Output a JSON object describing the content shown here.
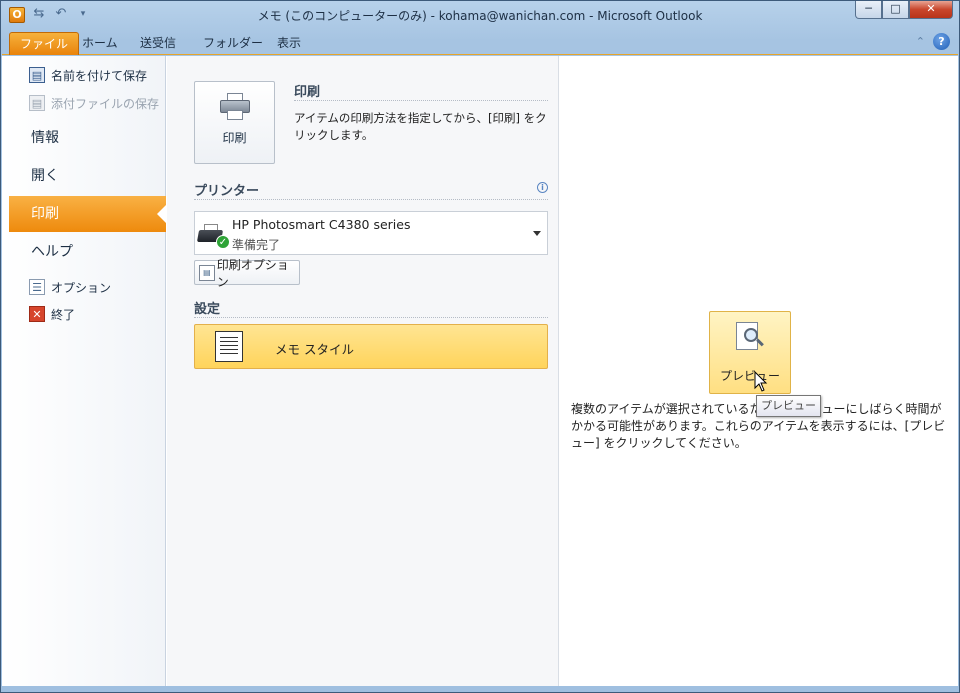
{
  "window": {
    "title": "メモ (このコンピューターのみ) - kohama@wanichan.com - Microsoft Outlook",
    "app_icon": "O",
    "controls": {
      "minimize": "─",
      "maximize": "□",
      "close": "✕"
    }
  },
  "ribbon": {
    "tabs": [
      {
        "label": "ファイル",
        "selected": true
      },
      {
        "label": "ホーム"
      },
      {
        "label": "送受信"
      },
      {
        "label": "フォルダー"
      },
      {
        "label": "表示"
      }
    ],
    "help": "?"
  },
  "backstage": {
    "commands_top": [
      {
        "label": "名前を付けて保存",
        "icon": "save-as-icon",
        "enabled": true
      },
      {
        "label": "添付ファイルの保存",
        "icon": "attachment-save-icon",
        "enabled": false
      }
    ],
    "tabs": [
      {
        "label": "情報"
      },
      {
        "label": "開く"
      },
      {
        "label": "印刷",
        "selected": true
      },
      {
        "label": "ヘルプ"
      }
    ],
    "commands_bottom": [
      {
        "label": "オプション",
        "icon": "options-icon"
      },
      {
        "label": "終了",
        "icon": "exit-icon"
      }
    ]
  },
  "print": {
    "button_label": "印刷",
    "heading": "印刷",
    "description": "アイテムの印刷方法を指定してから、[印刷] をクリックします。",
    "printer_heading": "プリンター",
    "printer_name": "HP Photosmart C4380 series",
    "printer_status": "準備完了",
    "options_button": "印刷オプション",
    "settings_heading": "設定",
    "style_label": "メモ スタイル"
  },
  "preview": {
    "button_label": "プレビュー",
    "tooltip": "プレビュー",
    "message": "複数のアイテムが選択されているため、プレビューにしばらく時間がかかる可能性があります。これらのアイテムを表示するには、[プレビュー] をクリックしてください。"
  },
  "colors": {
    "accent_orange": "#ee8a0d",
    "selection_yellow": "#ffd45b"
  }
}
